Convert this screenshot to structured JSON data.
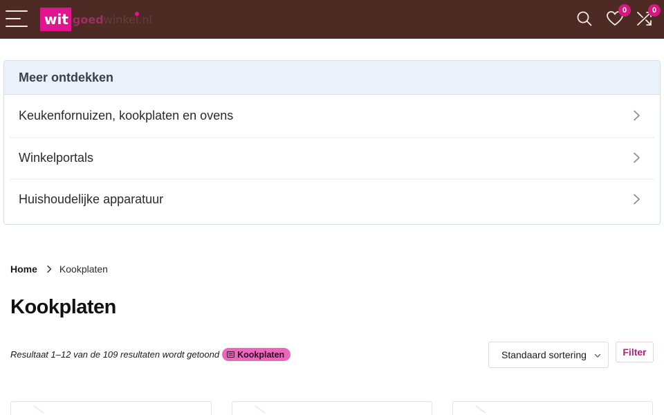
{
  "header": {
    "logo": {
      "box_text": "wit",
      "text_a": "goed",
      "text_b": "winkel.nl"
    },
    "wishlist_count": "0",
    "compare_count": "0",
    "icons": {
      "menu": "hamburger-icon",
      "search": "search-icon",
      "wishlist": "heart-icon",
      "compare": "shuffle-icon"
    }
  },
  "discover": {
    "title": "Meer ontdekken",
    "items": [
      {
        "label": "Keukenfornuizen, kookplaten en ovens"
      },
      {
        "label": "Winkelportals"
      },
      {
        "label": "Huishoudelijke apparatuur"
      }
    ]
  },
  "breadcrumb": {
    "home": "Home",
    "current": "Kookplaten"
  },
  "page": {
    "title": "Kookplaten"
  },
  "results": {
    "text": "Resultaat 1–12 van de 109 resultaten wordt getoond",
    "category_badge": "Kookplaten"
  },
  "sorting": {
    "selected": "Standaard sortering"
  },
  "filter": {
    "label": "Filter"
  },
  "colors": {
    "header_bg": "#4e2a24",
    "brand_pink": "#e0158f",
    "badge_bg": "#d4187f",
    "discover_head_bg": "#eaf1fb",
    "category_badge_bg": "#ee66bb"
  }
}
